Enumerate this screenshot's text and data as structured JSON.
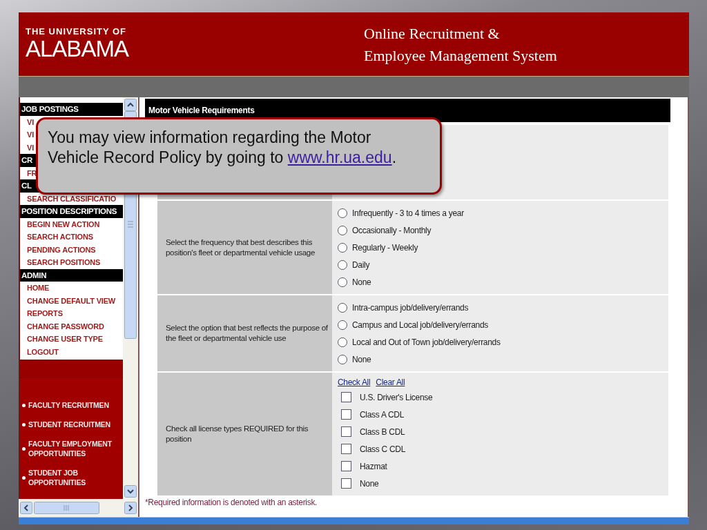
{
  "header": {
    "institution_line": "THE UNIVERSITY OF",
    "institution_name": "ALABAMA",
    "system_title": [
      "Online Recruitment &",
      "Employee Management System"
    ]
  },
  "sidebar": {
    "sections": [
      {
        "header": "JOB POSTINGS",
        "items": [
          "VI",
          "VI",
          "VI"
        ]
      },
      {
        "header": "CR",
        "items": [
          "FR"
        ]
      },
      {
        "header": "CL",
        "items": [
          "SEARCH CLASSIFICATIO"
        ]
      },
      {
        "header": "POSITION DESCRIPTIONS",
        "items": [
          "BEGIN NEW ACTION",
          "SEARCH ACTIONS",
          "PENDING ACTIONS",
          "SEARCH POSITIONS"
        ]
      },
      {
        "header": "ADMIN",
        "items": [
          "HOME",
          "CHANGE DEFAULT VIEW",
          "REPORTS",
          "CHANGE PASSWORD",
          "CHANGE USER TYPE",
          "LOGOUT"
        ]
      }
    ],
    "links": [
      "FACULTY RECRUITMEN",
      "STUDENT RECRUITMEN",
      "FACULTY EMPLOYMENT OPPORTUNITIES",
      "STUDENT JOB OPPORTUNITIES"
    ]
  },
  "section_title": "Motor Vehicle Requirements",
  "questions": [
    {
      "kind": "radio",
      "prompt": "Select the frequency that best describes this position's fleet or departmental vehicle usage",
      "options": [
        {
          "label": "Infrequently - 3 to 4 times a year",
          "selected": false
        },
        {
          "label": "Occasionally - Monthly",
          "selected": false
        },
        {
          "label": "Regularly - Weekly",
          "selected": false
        },
        {
          "label": "Daily",
          "selected": false
        },
        {
          "label": "None",
          "selected": false
        }
      ]
    },
    {
      "kind": "radio",
      "prompt": "Select the option that best reflects the purpose of the fleet or departmental vehicle use",
      "options": [
        {
          "label": "Intra-campus job/delivery/errands",
          "selected": false
        },
        {
          "label": "Campus and Local job/delivery/errands",
          "selected": false
        },
        {
          "label": "Local and Out of Town job/delivery/errands",
          "selected": false
        },
        {
          "label": "None",
          "selected": false
        }
      ]
    },
    {
      "kind": "checkbox",
      "prompt": "Check all license types REQUIRED for this position",
      "actions": [
        "Check All",
        "Clear All"
      ],
      "options": [
        {
          "label": "U.S. Driver's License",
          "checked": false
        },
        {
          "label": "Class A CDL",
          "checked": false
        },
        {
          "label": "Class B CDL",
          "checked": false
        },
        {
          "label": "Class C CDL",
          "checked": false
        },
        {
          "label": "Hazmat",
          "checked": false
        },
        {
          "label": "None",
          "checked": false
        }
      ]
    }
  ],
  "footnote": "*Required information is denoted with an asterisk.",
  "callout": {
    "text": "You may view information regarding the Motor Vehicle Record Policy by going to",
    "link": "www.hr.ua.edu",
    "after": "."
  }
}
